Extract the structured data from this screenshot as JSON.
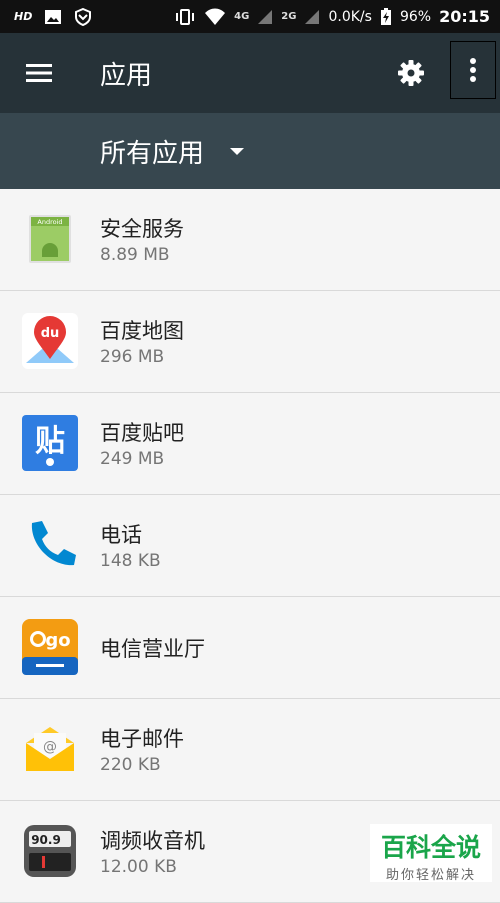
{
  "status_bar": {
    "hd": "HD",
    "net_4g": "4G",
    "net_2g": "2G",
    "speed": "0.0K/s",
    "battery": "96%",
    "time": "20:15"
  },
  "app_bar": {
    "title": "应用"
  },
  "filter": {
    "label": "所有应用"
  },
  "apps": [
    {
      "name": "安全服务",
      "size": "8.89 MB"
    },
    {
      "name": "百度地图",
      "size": "296 MB"
    },
    {
      "name": "百度贴吧",
      "size": "249 MB"
    },
    {
      "name": "电话",
      "size": "148 KB"
    },
    {
      "name": "电信营业厅",
      "size": ""
    },
    {
      "name": "电子邮件",
      "size": "220 KB"
    },
    {
      "name": "调频收音机",
      "size": "12.00 KB"
    }
  ],
  "icon_text": {
    "android": "Android",
    "du": "du",
    "tieba": "贴",
    "ego": "go",
    "radio_freq": "90.9"
  },
  "watermark": {
    "main": "百科全说",
    "sub": "助你轻松解决"
  },
  "colors": {
    "app_bar": "#263238",
    "filter_bar": "#37474f",
    "list_bg": "#f5f5f5"
  }
}
